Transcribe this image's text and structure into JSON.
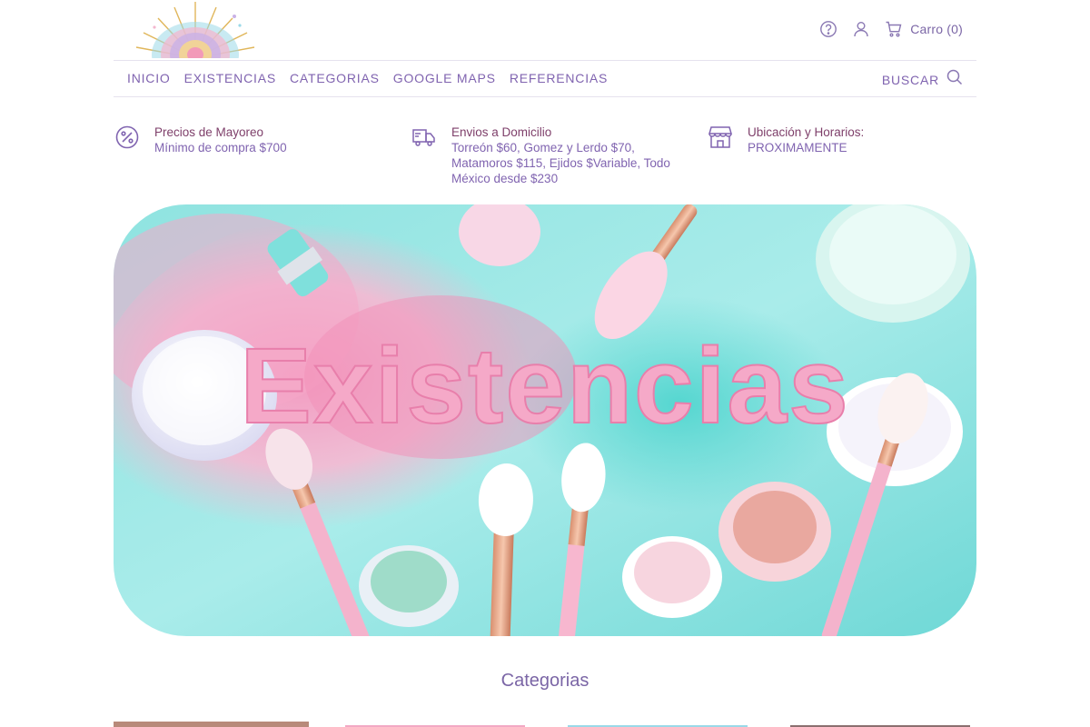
{
  "header": {
    "logo_alt": "logo",
    "cart_label": "Carro (0)",
    "icons": [
      "help-icon",
      "user-icon",
      "cart-icon"
    ]
  },
  "nav": {
    "items": [
      {
        "label": "INICIO"
      },
      {
        "label": "EXISTENCIAS"
      },
      {
        "label": "CATEGORIAS"
      },
      {
        "label": "GOOGLE MAPS"
      },
      {
        "label": "REFERENCIAS"
      }
    ],
    "search_label": "BUSCAR"
  },
  "info": [
    {
      "title": "Precios de Mayoreo",
      "desc": "Mínimo de compra $700",
      "icon": "percent-icon"
    },
    {
      "title": "Envios a Domicilio",
      "desc": "Torreón $60, Gomez y Lerdo $70, Matamoros $115, Ejidos $Variable, Todo México desde $230",
      "icon": "truck-icon"
    },
    {
      "title": "Ubicación y Horarios:",
      "desc": "PROXIMAMENTE",
      "icon": "store-icon"
    }
  ],
  "banner": {
    "text": "Existencias"
  },
  "sections": {
    "categories_title": "Categorias"
  },
  "colors": {
    "accent": "#8064b0",
    "title": "#7e3f6a",
    "pink": "#f4a9c9",
    "teal": "#7fe0dc"
  }
}
